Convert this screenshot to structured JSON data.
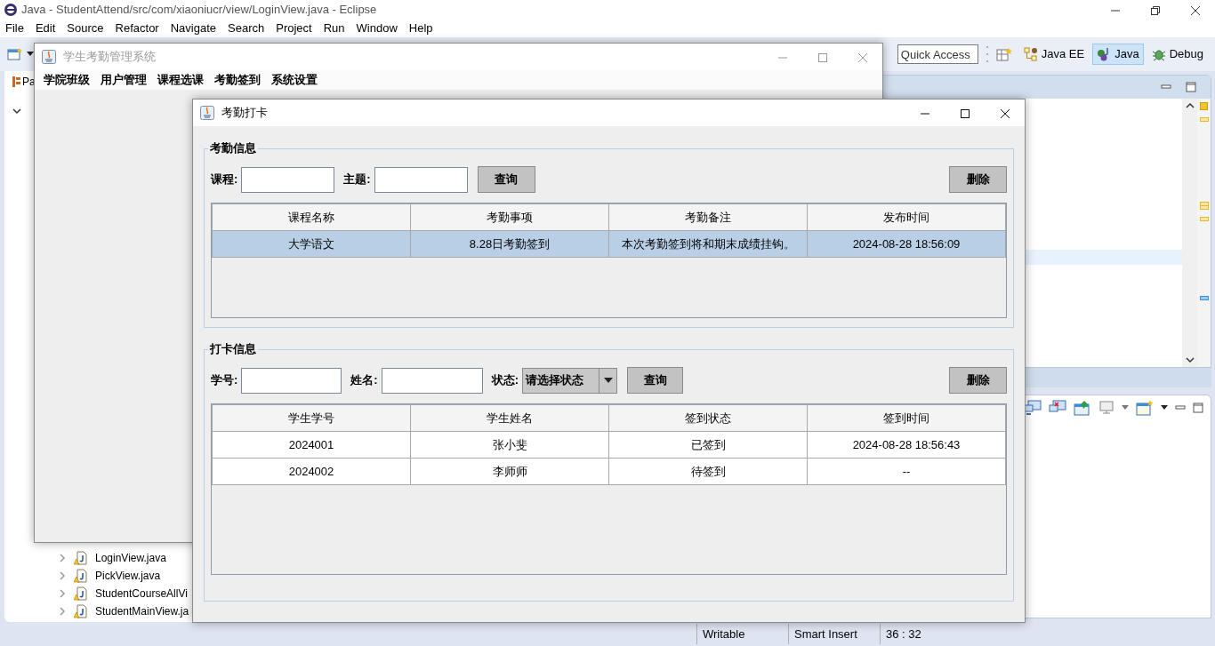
{
  "ide": {
    "title": "Java - StudentAttend/src/com/xiaoniucr/view/LoginView.java - Eclipse",
    "menu": [
      "File",
      "Edit",
      "Source",
      "Refactor",
      "Navigate",
      "Search",
      "Project",
      "Run",
      "Window",
      "Help"
    ],
    "quick_access": {
      "placeholder": "Quick Access"
    },
    "perspectives": [
      {
        "label": "Java EE",
        "selected": false
      },
      {
        "label": "Java",
        "selected": true
      },
      {
        "label": "Debug",
        "selected": false
      }
    ],
    "explorer_tab": "Pa",
    "tree_items": [
      {
        "label": "LoginView.java",
        "expanded": false
      },
      {
        "label": "PickView.java",
        "expanded": false
      },
      {
        "label": "StudentCourseAllVi",
        "expanded": false
      },
      {
        "label": "StudentMainView.ja",
        "expanded": false
      }
    ],
    "status_bar": [
      "Writable",
      "Smart Insert",
      "36 : 32"
    ]
  },
  "main_window": {
    "title": "学生考勤管理系统",
    "active": false,
    "menu": [
      "学院班级",
      "用户管理",
      "课程选课",
      "考勤签到",
      "系统设置"
    ]
  },
  "dialog": {
    "title": "考勤打卡",
    "active": true,
    "sections": [
      {
        "legend": "考勤信息",
        "filters": [
          {
            "kind": "text",
            "label": "课程:"
          },
          {
            "kind": "text",
            "label": "主题:"
          }
        ],
        "query_button": "查询",
        "delete_button": "删除",
        "columns": [
          "课程名称",
          "考勤事项",
          "考勤备注",
          "发布时间"
        ],
        "rows": [
          {
            "cells": [
              "大学语文",
              "8.28日考勤签到",
              "本次考勤签到将和期末成绩挂钩。",
              "2024-08-28 18:56:09"
            ],
            "selected": true
          }
        ]
      },
      {
        "legend": "打卡信息",
        "filters": [
          {
            "kind": "text",
            "label": "学号:"
          },
          {
            "kind": "text",
            "label": "姓名:"
          },
          {
            "kind": "select",
            "label": "状态:",
            "value": "请选择状态"
          }
        ],
        "query_button": "查询",
        "delete_button": "删除",
        "columns": [
          "学生学号",
          "学生姓名",
          "签到状态",
          "签到时间"
        ],
        "rows": [
          {
            "cells": [
              "2024001",
              "张小斐",
              "已签到",
              "2024-08-28 18:56:43"
            ],
            "selected": false
          },
          {
            "cells": [
              "2024002",
              "李师师",
              "待签到",
              "--"
            ],
            "selected": false
          }
        ]
      }
    ]
  }
}
